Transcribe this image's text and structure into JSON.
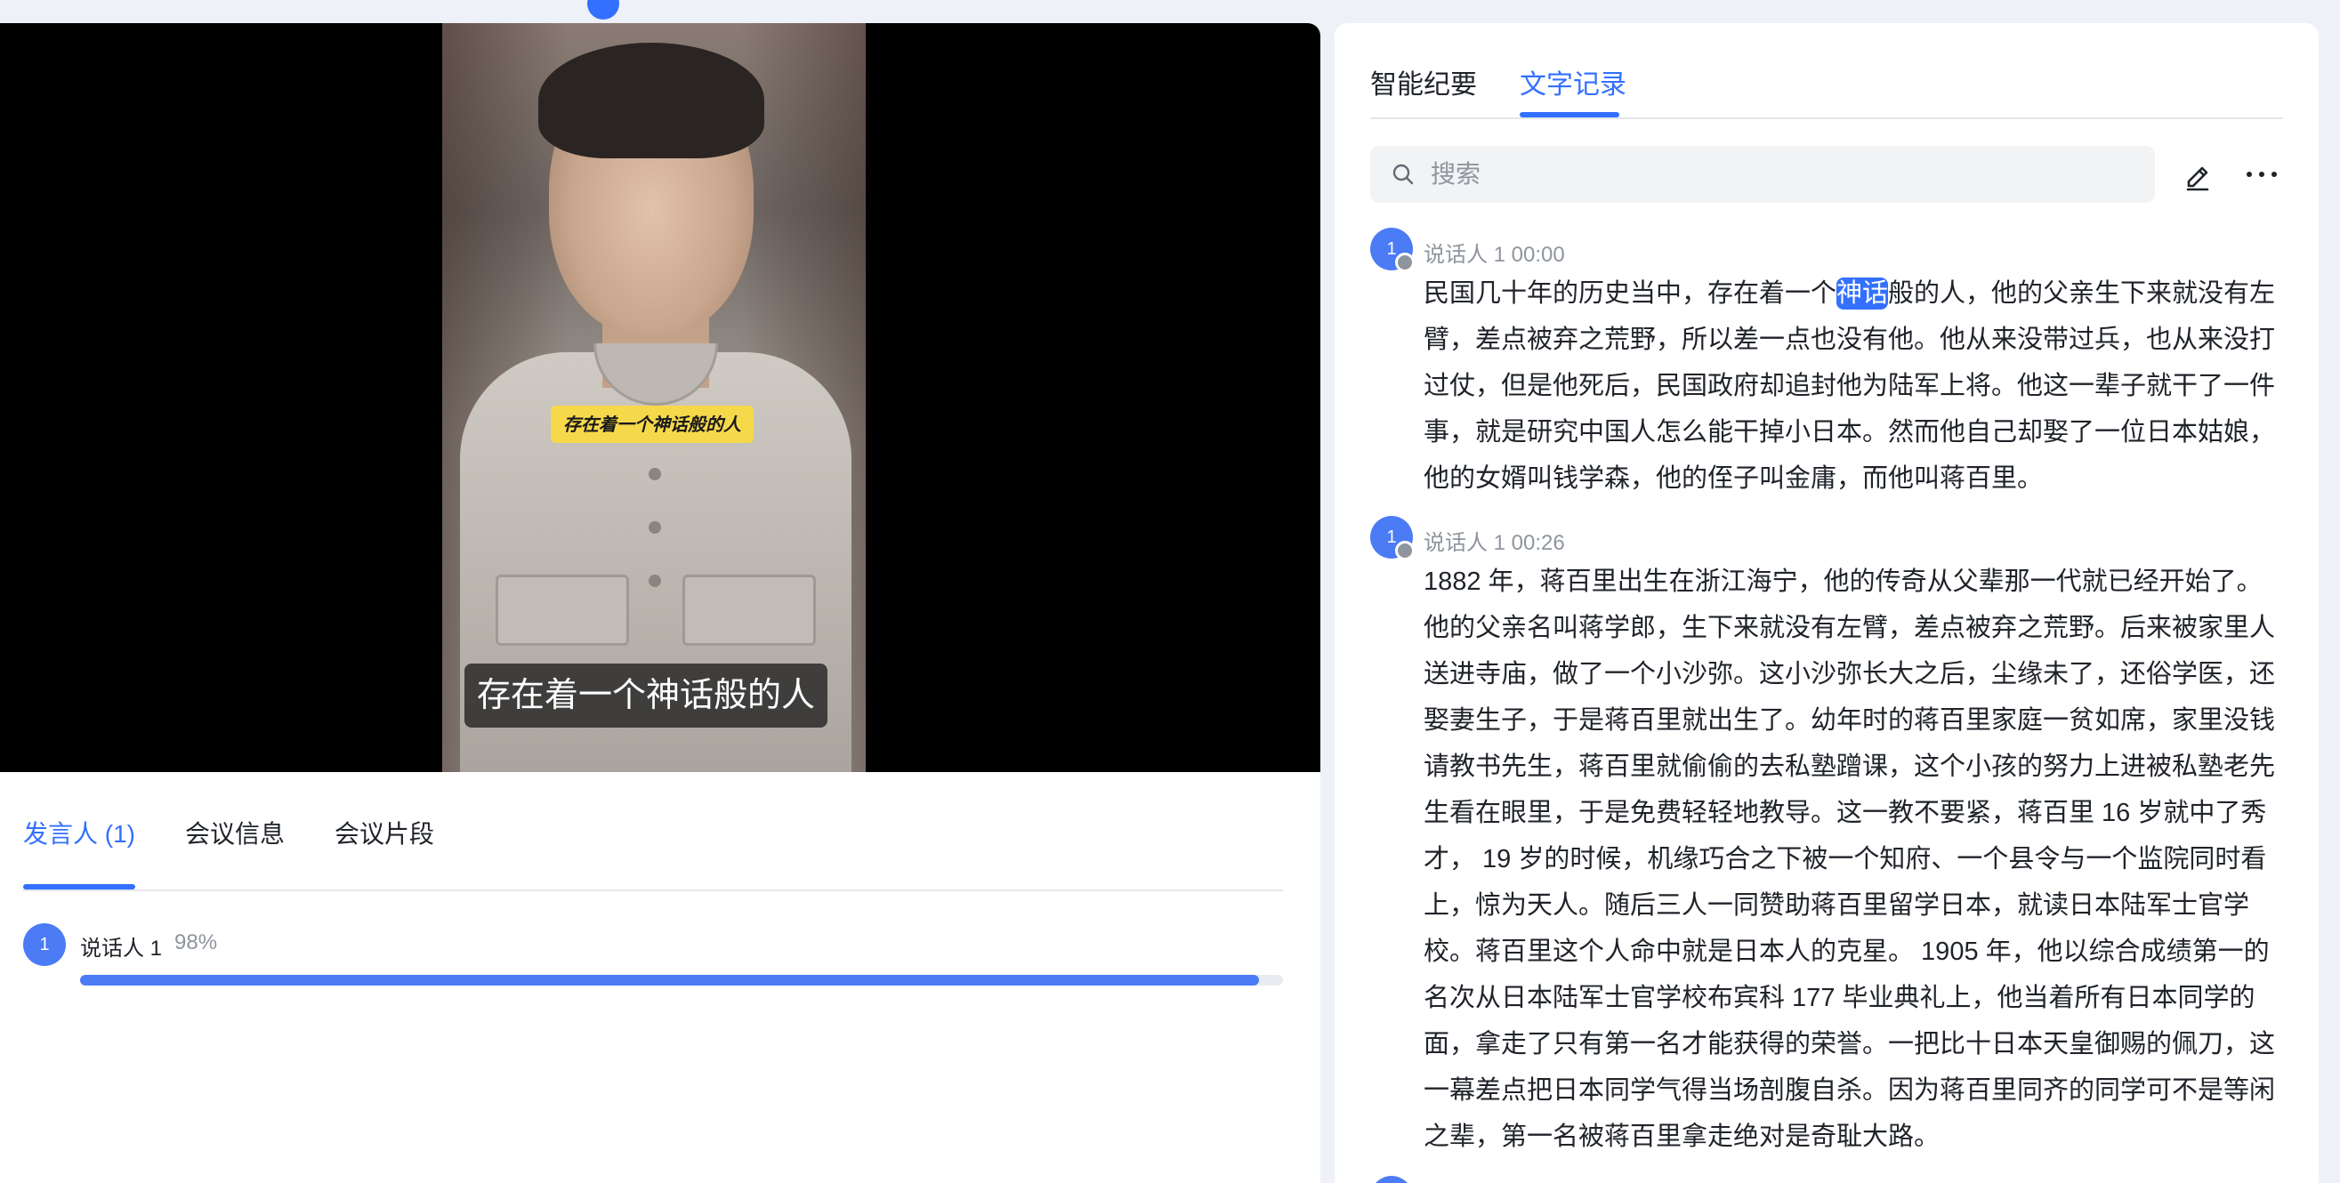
{
  "video": {
    "sticker_text": "存在着一个神话般的人",
    "subtitle": "存在着一个神话般的人"
  },
  "left_tabs": [
    {
      "label": "发言人 (1)",
      "active": true
    },
    {
      "label": "会议信息",
      "active": false
    },
    {
      "label": "会议片段",
      "active": false
    }
  ],
  "speakers": [
    {
      "avatar": "1",
      "name": "说话人 1",
      "percent": "98%",
      "share": 0.98
    }
  ],
  "right_tabs": [
    {
      "label": "智能纪要",
      "active": false
    },
    {
      "label": "文字记录",
      "active": true
    }
  ],
  "search": {
    "placeholder": "搜索",
    "value": ""
  },
  "icons": {
    "search": "search-icon",
    "edit": "edit-pencil-icon",
    "more": "more-horizontal-icon"
  },
  "colors": {
    "accent": "#3370ff",
    "avatar": "#4b7bf5"
  },
  "transcript": [
    {
      "avatar": "1",
      "meta": "说话人 1 00:00",
      "text_before": "民国几十年的历史当中，存在着一个",
      "highlight": "神话",
      "text_after": "般的人，他的父亲生下来就没有左臂，差点被弃之荒野，所以差一点也没有他。他从来没带过兵，也从来没打过仗，但是他死后，民国政府却追封他为陆军上将。他这一辈子就干了一件事，就是研究中国人怎么能干掉小日本。然而他自己却娶了一位日本姑娘，他的女婿叫钱学森，他的侄子叫金庸，而他叫蒋百里。"
    },
    {
      "avatar": "1",
      "meta": "说话人 1 00:26",
      "text": "1882 年，蒋百里出生在浙江海宁，他的传奇从父辈那一代就已经开始了。他的父亲名叫蒋学郎，生下来就没有左臂，差点被弃之荒野。后来被家里人送进寺庙，做了一个小沙弥。这小沙弥长大之后，尘缘未了，还俗学医，还娶妻生子，于是蒋百里就出生了。幼年时的蒋百里家庭一贫如席，家里没钱请教书先生，蒋百里就偷偷的去私塾蹭课，这个小孩的努力上进被私塾老先生看在眼里，于是免费轻轻地教导。这一教不要紧，蒋百里 16 岁就中了秀才， 19 岁的时候，机缘巧合之下被一个知府、一个县令与一个监院同时看上，惊为天人。随后三人一同赞助蒋百里留学日本，就读日本陆军士官学校。蒋百里这个人命中就是日本人的克星。 1905 年，他以综合成绩第一的名次从日本陆军士官学校布宾科 177 毕业典礼上，他当着所有日本同学的面，拿走了只有第一名才能获得的荣誉。一把比十日本天皇御赐的佩刀，这一幕差点把日本同学气得当场剖腹自杀。因为蒋百里同齐的同学可不是等闲之辈，第一名被蒋百里拿走绝对是奇耻大路。"
    }
  ]
}
